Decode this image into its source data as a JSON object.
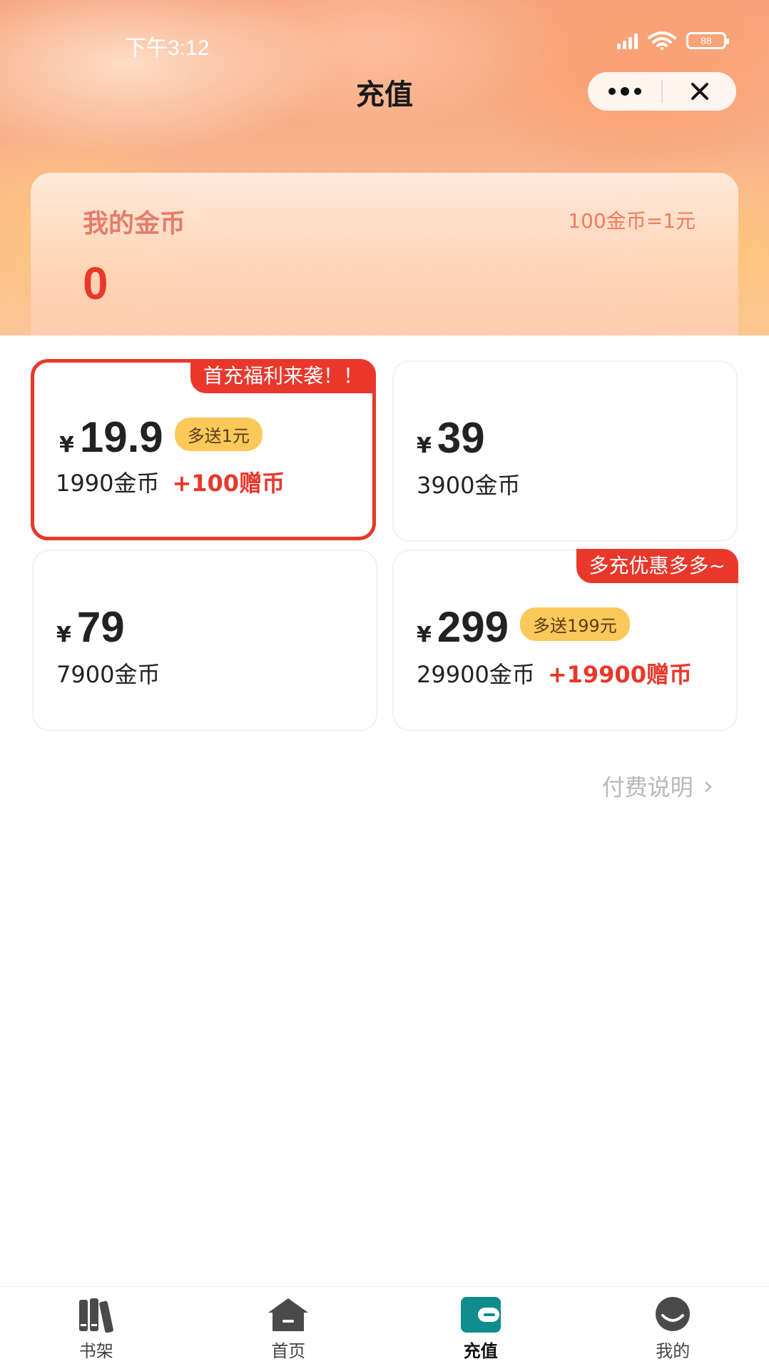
{
  "status_bar": {
    "time": "下午3:12",
    "battery": "88"
  },
  "header": {
    "title": "充值"
  },
  "coin_card": {
    "label": "我的金币",
    "rate": "100金币=1元",
    "balance": "0"
  },
  "options": [
    {
      "ribbon": "首充福利来袭！！",
      "currency": "¥",
      "price": "19.9",
      "bonus_tag": "多送1元",
      "coins": "1990金币",
      "gift": "+100赠币",
      "selected": true
    },
    {
      "ribbon": "",
      "currency": "¥",
      "price": "39",
      "bonus_tag": "",
      "coins": "3900金币",
      "gift": "",
      "selected": false
    },
    {
      "ribbon": "",
      "currency": "¥",
      "price": "79",
      "bonus_tag": "",
      "coins": "7900金币",
      "gift": "",
      "selected": false
    },
    {
      "ribbon": "多充优惠多多~",
      "currency": "¥",
      "price": "299",
      "bonus_tag": "多送199元",
      "coins": "29900金币",
      "gift": "+19900赠币",
      "selected": false
    }
  ],
  "pay_info": {
    "label": "付费说明"
  },
  "tabbar": {
    "items": [
      {
        "label": "书架",
        "icon": "bookshelf-icon"
      },
      {
        "label": "首页",
        "icon": "home-icon"
      },
      {
        "label": "充值",
        "icon": "wallet-icon",
        "active": true
      },
      {
        "label": "我的",
        "icon": "profile-icon"
      }
    ]
  },
  "colors": {
    "accent": "#e8382a",
    "tab_active": "#0f8c8c",
    "bonus_tag": "#fbc85a"
  }
}
